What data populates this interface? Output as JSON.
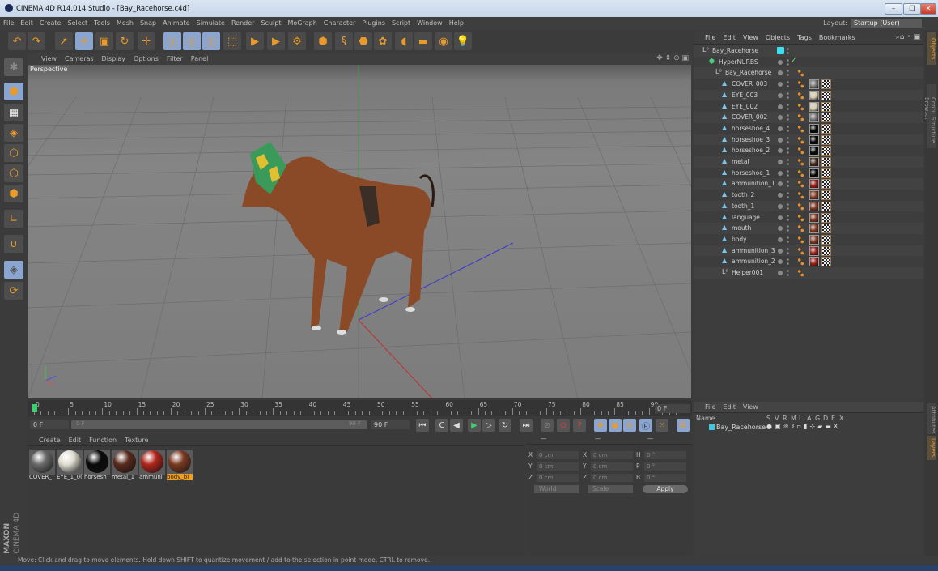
{
  "window": {
    "title": "CINEMA 4D R14.014 Studio - [Bay_Racehorse.c4d]",
    "minimize": "–",
    "restore": "❐",
    "close": "✕"
  },
  "menu": [
    "File",
    "Edit",
    "Create",
    "Select",
    "Tools",
    "Mesh",
    "Snap",
    "Animate",
    "Simulate",
    "Render",
    "Sculpt",
    "MoGraph",
    "Character",
    "Plugins",
    "Script",
    "Window",
    "Help"
  ],
  "layout": {
    "label": "Layout:",
    "value": "Startup (User)"
  },
  "toolbar": {
    "icons": [
      "undo-icon",
      "redo-icon",
      "live-selection-icon",
      "move-icon",
      "scale-icon",
      "rotate-icon",
      "add-object-icon",
      "x-axis-icon",
      "y-axis-icon",
      "z-axis-icon",
      "coordinate-system-icon",
      "render-view-icon",
      "render-picture-viewer-icon",
      "render-settings-icon",
      "cube-icon",
      "spline-icon",
      "nurbs-icon",
      "array-icon",
      "deformer-icon",
      "floor-icon",
      "camera-icon",
      "light-icon"
    ]
  },
  "viewport": {
    "menu": [
      "View",
      "Cameras",
      "Display",
      "Options",
      "Filter",
      "Panel"
    ],
    "label": "Perspective"
  },
  "timeline": {
    "ticks": [
      "0",
      "5",
      "10",
      "15",
      "20",
      "25",
      "30",
      "35",
      "40",
      "45",
      "50",
      "55",
      "60",
      "65",
      "70",
      "75",
      "80",
      "85",
      "90"
    ],
    "current_frame": "0 F"
  },
  "controls": {
    "start": "0 F",
    "range_start": "0 F",
    "range_end": "90 F",
    "end": "90 F"
  },
  "material_manager": {
    "menu": [
      "Create",
      "Edit",
      "Function",
      "Texture"
    ],
    "materials": [
      {
        "name": "COVER_",
        "color": "#6a6a6a"
      },
      {
        "name": "EYE_1_0(",
        "color": "#e0ddd0"
      },
      {
        "name": "horsesh",
        "color": "#0a0a0a"
      },
      {
        "name": "metal_1",
        "color": "#5a2a1e"
      },
      {
        "name": "ammuni",
        "color": "#b0251c"
      },
      {
        "name": "body_bi",
        "color": "#7a3a22",
        "selected": true
      }
    ]
  },
  "coordinates": {
    "headers": [
      "—",
      "—",
      "—"
    ],
    "rows": [
      {
        "a": "X",
        "av": "0 cm",
        "b": "X",
        "bv": "0 cm",
        "c": "H",
        "cv": "0 °"
      },
      {
        "a": "Y",
        "av": "0 cm",
        "b": "Y",
        "bv": "0 cm",
        "c": "P",
        "cv": "0 °"
      },
      {
        "a": "Z",
        "av": "0 cm",
        "b": "Z",
        "bv": "0 cm",
        "c": "B",
        "cv": "0 °"
      }
    ],
    "mode": "World",
    "type": "Scale",
    "apply": "Apply"
  },
  "object_manager": {
    "menu": [
      "File",
      "Edit",
      "View",
      "Objects",
      "Tags",
      "Bookmarks"
    ],
    "objects": [
      {
        "name": "Bay_Racehorse",
        "type": "null",
        "indent": 0
      },
      {
        "name": "HyperNURBS",
        "type": "nurbs",
        "indent": 1
      },
      {
        "name": "Bay_Racehorse",
        "type": "null",
        "indent": 2
      },
      {
        "name": "COVER_003",
        "type": "poly",
        "indent": 3,
        "mat": "#7a7a7a"
      },
      {
        "name": "EYE_003",
        "type": "poly",
        "indent": 3,
        "mat": "#d8cbb0"
      },
      {
        "name": "EYE_002",
        "type": "poly",
        "indent": 3,
        "mat": "#d8cbb0"
      },
      {
        "name": "COVER_002",
        "type": "poly",
        "indent": 3,
        "mat": "#7a7a7a"
      },
      {
        "name": "horseshoe_4",
        "type": "poly",
        "indent": 3,
        "mat": "#050505"
      },
      {
        "name": "horseshoe_3",
        "type": "poly",
        "indent": 3,
        "mat": "#050505"
      },
      {
        "name": "horseshoe_2",
        "type": "poly",
        "indent": 3,
        "mat": "#050505"
      },
      {
        "name": "metal",
        "type": "poly",
        "indent": 3,
        "mat": "#4a2a1a"
      },
      {
        "name": "horseshoe_1",
        "type": "poly",
        "indent": 3,
        "mat": "#050505"
      },
      {
        "name": "ammunition_1",
        "type": "poly",
        "indent": 3,
        "mat": "#a02018"
      },
      {
        "name": "tooth_2",
        "type": "poly",
        "indent": 3,
        "mat": "#8a3a22"
      },
      {
        "name": "tooth_1",
        "type": "poly",
        "indent": 3,
        "mat": "#8a3a22"
      },
      {
        "name": "language",
        "type": "poly",
        "indent": 3,
        "mat": "#8a3a22"
      },
      {
        "name": "mouth",
        "type": "poly",
        "indent": 3,
        "mat": "#8a3a22"
      },
      {
        "name": "body",
        "type": "poly",
        "indent": 3,
        "mat": "#8a3a22"
      },
      {
        "name": "ammunition_3",
        "type": "poly",
        "indent": 3,
        "mat": "#a02018"
      },
      {
        "name": "ammunition_2",
        "type": "poly",
        "indent": 3,
        "mat": "#a02018"
      },
      {
        "name": "Helper001",
        "type": "null",
        "indent": 3
      }
    ]
  },
  "layer_manager": {
    "menu": [
      "File",
      "Edit",
      "View"
    ],
    "name_header": "Name",
    "columns": [
      "S",
      "V",
      "R",
      "M",
      "L",
      "A",
      "G",
      "D",
      "E",
      "X"
    ],
    "layer": "Bay_Racehorse",
    "layer_color": "#3ec8e0"
  },
  "right_tabs": [
    "Objects",
    "Content Browser",
    "Structure",
    "Attributes",
    "Layers"
  ],
  "brand": {
    "top": "MAXON",
    "bottom": "CINEMA 4D"
  },
  "status": "Move: Click and drag to move elements. Hold down SHIFT to quantize movement / add to the selection in point mode, CTRL to remove.",
  "colors": {
    "accent": "#e89a2c",
    "highlight": "#8aa6d0",
    "panel": "#3b3b3b"
  }
}
